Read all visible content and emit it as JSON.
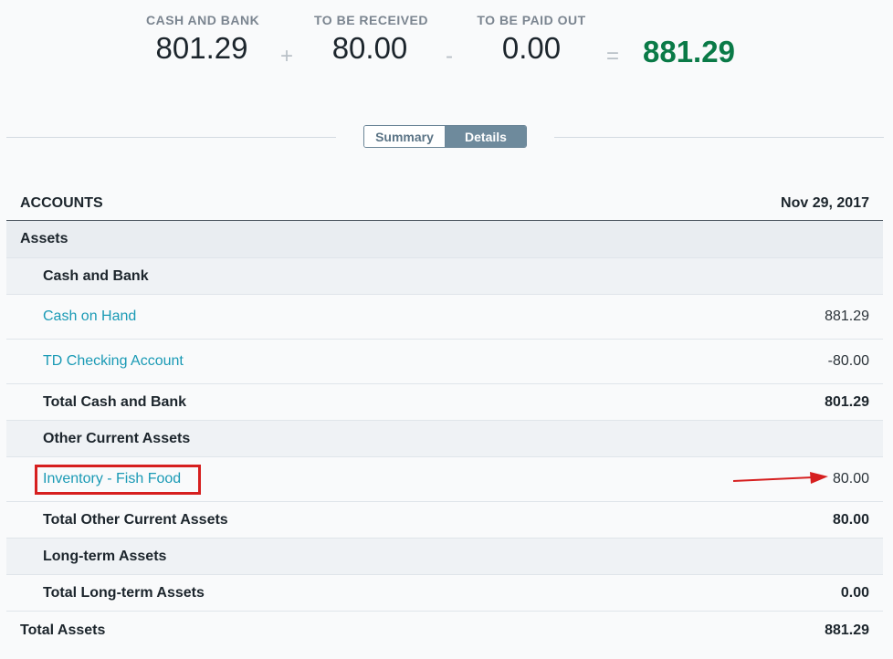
{
  "summary": {
    "cash_bank": {
      "label": "CASH AND BANK",
      "value": "801.29"
    },
    "plus": "+",
    "to_receive": {
      "label": "TO BE RECEIVED",
      "value": "80.00"
    },
    "minus": "-",
    "to_pay": {
      "label": "TO BE PAID OUT",
      "value": "0.00"
    },
    "equals": "=",
    "net": "881.29",
    "net_color": "#0a7a47"
  },
  "toggle": {
    "summary_label": "Summary",
    "details_label": "Details",
    "active": "Details"
  },
  "table": {
    "header_accounts": "ACCOUNTS",
    "header_date": "Nov 29, 2017",
    "assets_label": "Assets",
    "cash_bank": {
      "title": "Cash and Bank",
      "accounts": [
        {
          "name": "Cash on Hand",
          "value": "881.29"
        },
        {
          "name": "TD Checking Account",
          "value": "-80.00"
        }
      ],
      "total_label": "Total Cash and Bank",
      "total_value": "801.29"
    },
    "other_current": {
      "title": "Other Current Assets",
      "accounts": [
        {
          "name": "Inventory - Fish Food",
          "value": "80.00"
        }
      ],
      "total_label": "Total Other Current Assets",
      "total_value": "80.00"
    },
    "long_term": {
      "title": "Long-term Assets",
      "total_label": "Total Long-term Assets",
      "total_value": "0.00"
    },
    "total_assets_label": "Total Assets",
    "total_assets_value": "881.29"
  },
  "colors": {
    "link": "#1a9ab5",
    "annotation": "#d61f1f"
  }
}
